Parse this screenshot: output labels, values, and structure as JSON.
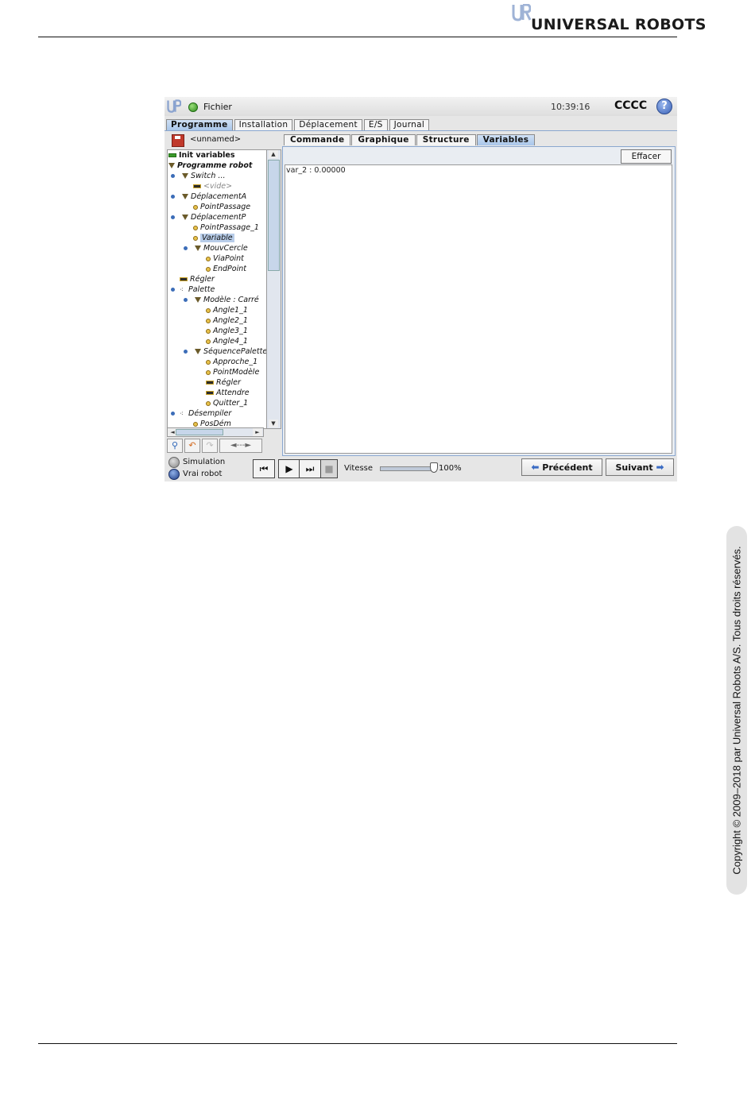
{
  "page": {
    "brand": "UNIVERSAL ROBOTS",
    "copyright": "Copyright © 2009–2018 par Universal Robots A/S. Tous droits réservés."
  },
  "app": {
    "file_menu": "Fichier",
    "time": "10:39:16",
    "robot_name": "CCCC",
    "help": "?",
    "main_tabs": [
      "Programme",
      "Installation",
      "Déplacement",
      "E/S",
      "Journal"
    ],
    "program_name": "<unnamed>",
    "tree": [
      {
        "label": "Init variables",
        "icon": "green-bar-icon"
      },
      {
        "label": "Programme robot",
        "icon": "triangle-icon"
      },
      {
        "label": "Switch ...",
        "icon": "triangle-icon"
      },
      {
        "label": "<vide>",
        "icon": "bar-icon"
      },
      {
        "label": "DéplacementA",
        "icon": "triangle-icon"
      },
      {
        "label": "PointPassage",
        "icon": "dot-icon"
      },
      {
        "label": "DéplacementP",
        "icon": "triangle-icon"
      },
      {
        "label": "PointPassage_1",
        "icon": "dot-icon"
      },
      {
        "label": "Variable",
        "icon": "dot-icon"
      },
      {
        "label": "MouvCercle",
        "icon": "triangle-icon"
      },
      {
        "label": "ViaPoint",
        "icon": "dot-icon"
      },
      {
        "label": "EndPoint",
        "icon": "dot-icon"
      },
      {
        "label": "Régler",
        "icon": "bar-icon"
      },
      {
        "label": "Palette",
        "icon": "pallet-icon"
      },
      {
        "label": "Modèle : Carré",
        "icon": "triangle-icon"
      },
      {
        "label": "Angle1_1",
        "icon": "dot-icon"
      },
      {
        "label": "Angle2_1",
        "icon": "dot-icon"
      },
      {
        "label": "Angle3_1",
        "icon": "dot-icon"
      },
      {
        "label": "Angle4_1",
        "icon": "dot-icon"
      },
      {
        "label": "SéquencePalette",
        "icon": "triangle-icon"
      },
      {
        "label": "Approche_1",
        "icon": "dot-icon"
      },
      {
        "label": "PointModèle",
        "icon": "dot-icon"
      },
      {
        "label": "Régler",
        "icon": "bar-icon"
      },
      {
        "label": "Attendre",
        "icon": "bar-icon"
      },
      {
        "label": "Quitter_1",
        "icon": "dot-icon"
      },
      {
        "label": "Désempiler",
        "icon": "pallet-icon"
      },
      {
        "label": "PosDém",
        "icon": "dot-icon"
      }
    ],
    "tree_tools": {
      "search": "search-icon",
      "undo": "undo-icon",
      "redo": "redo-icon",
      "drag_label": "◄---►"
    },
    "sub_tabs": [
      "Commande",
      "Graphique",
      "Structure",
      "Variables"
    ],
    "active_sub_tab": "Variables",
    "clear_button": "Effacer",
    "variables": [
      "var_2 : 0.00000"
    ],
    "mode": {
      "simulation": "Simulation",
      "real": "Vrai robot"
    },
    "speed": {
      "label": "Vitesse",
      "value": "100%",
      "level": 1.0
    },
    "nav": {
      "prev": "Précédent",
      "next": "Suivant"
    },
    "colors": {
      "accent": "#a9c6ea",
      "selection": "#b8cde9"
    }
  }
}
